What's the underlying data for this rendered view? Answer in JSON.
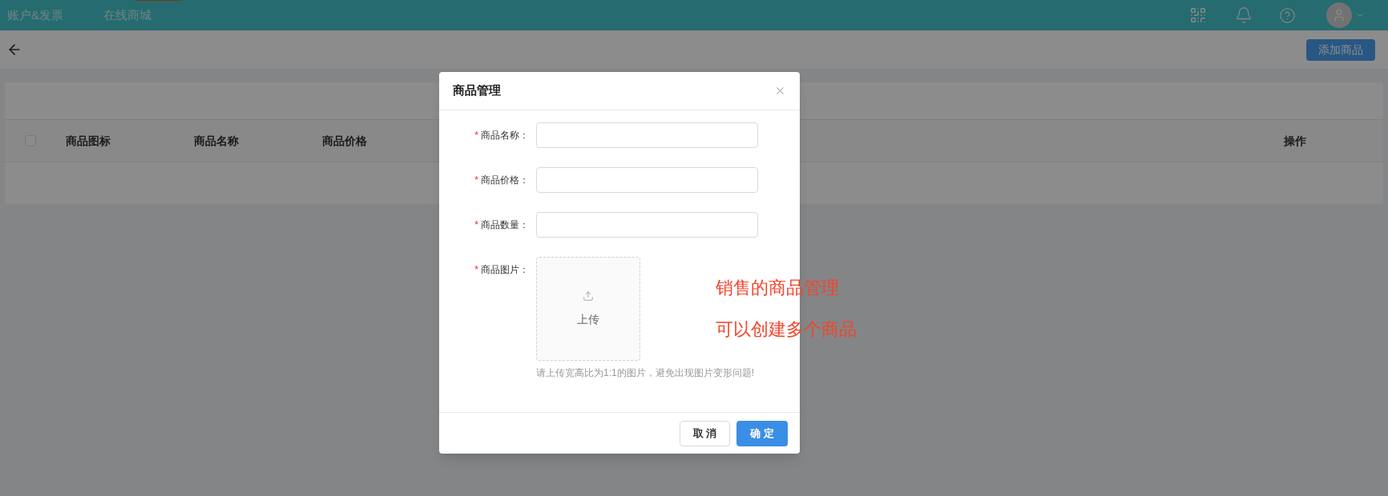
{
  "top_nav": {
    "items": [
      {
        "label": "账户&发票",
        "badge": false
      },
      {
        "label": "在线商城",
        "badge": true
      }
    ]
  },
  "toolbar": {
    "add_button": "添加商品"
  },
  "table": {
    "select_all_checked": false,
    "columns": [
      "商品图标",
      "商品名称",
      "商品价格"
    ],
    "action_column": "操作"
  },
  "dialog": {
    "title": "商品管理",
    "fields": [
      {
        "kind": "input",
        "label": "商品名称：",
        "required_mark": "*"
      },
      {
        "kind": "input",
        "label": "商品价格：",
        "required_mark": "*"
      },
      {
        "kind": "input",
        "label": "商品数量：",
        "required_mark": "*"
      },
      {
        "kind": "upload",
        "label": "商品图片：",
        "required_mark": "*",
        "upload_text": "上传",
        "hint": "请上传宽高比为1:1的图片，避免出现图片变形问题!"
      }
    ],
    "cancel": "取 消",
    "ok": "确 定"
  },
  "annotations": [
    "销售的商品管理",
    "可以创建多个商品"
  ]
}
